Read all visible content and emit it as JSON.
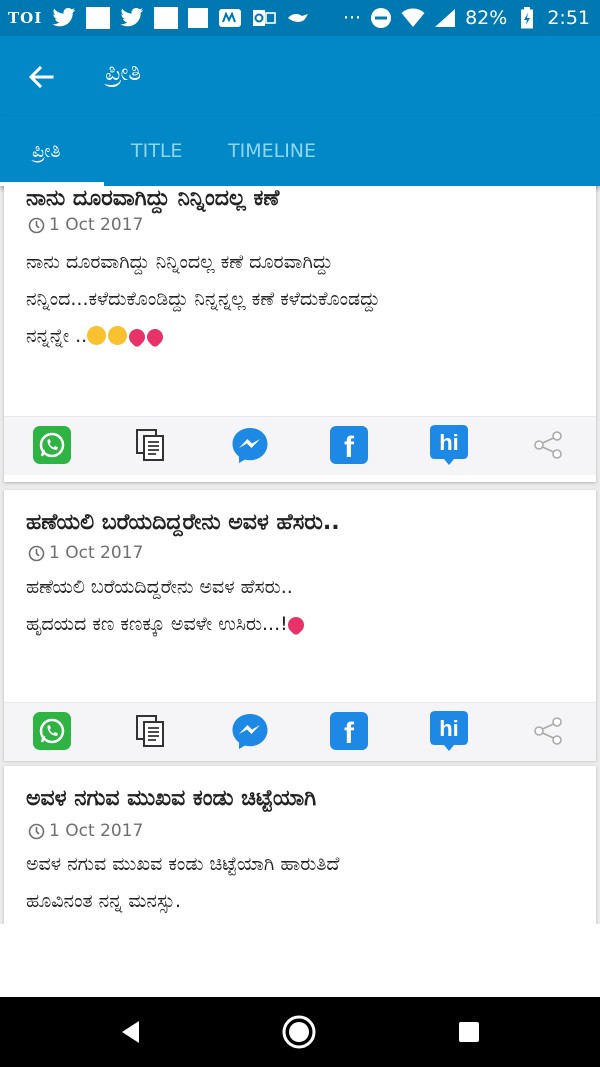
{
  "status_bar": {
    "left_label": "TOI",
    "more": "···",
    "battery": "82%",
    "time": "2:51",
    "icons": [
      "twitter-icon",
      "square-icon",
      "twitter-icon",
      "square-icon",
      "square-icon",
      "mywall-icon",
      "outlook-icon",
      "bird-icon",
      "dnd-icon",
      "wifi-icon",
      "signal-icon",
      "battery-icon"
    ]
  },
  "app_bar": {
    "title": "ಪ್ರೀತಿ"
  },
  "tabs": [
    {
      "label": "ಪ್ರೀತಿ",
      "active": true
    },
    {
      "label": "TITLE",
      "active": false
    },
    {
      "label": "TIMELINE",
      "active": false
    }
  ],
  "posts": [
    {
      "title": "ನಾನು ದೂರವಾಗಿದ್ದು ನಿನ್ನಿಂದಲ್ಲ ಕಣೆ",
      "date": "1 Oct 2017",
      "lines": [
        "ನಾನು ದೂರವಾಗಿದ್ದು ನಿನ್ನಿಂದಲ್ಲ ಕಣೆ ದೂರವಾಗಿದ್ದು",
        "ನನ್ನಿಂದ...ಕಳೆದುಕೊಂಡಿದ್ದು ನಿನ್ನನ್ನಲ್ಲ ಕಣೆ ಕಳೆದುಕೊಂಡದ್ದು",
        "ನನ್ನನ್ನೇ .."
      ]
    },
    {
      "title": "ಹಣೆಯಲಿ ಬರೆಯದಿದ್ದರೇನು ಅವಳ ಹೆಸರು..",
      "date": "1 Oct 2017",
      "lines": [
        "ಹಣೆಯಲಿ ಬರೆಯದಿದ್ದರೇನು ಅವಳ ಹೆಸರು..",
        "ಹೃದಯದ ಕಣ ಕಣಕ್ಕೂ ಅವಳೇ ಉಸಿರು...!"
      ]
    },
    {
      "title": "ಅವಳ ನಗುವ ಮುಖವ ಕಂಡು ಚಿಟ್ಟೆಯಾಗಿ",
      "date": "1 Oct 2017",
      "lines": [
        "ಅವಳ ನಗುವ ಮುಖವ ಕಂಡು ಚಿಟ್ಟೆಯಾಗಿ ಹಾರುತಿದೆ",
        "ಹೂವಿನಂತ ನನ್ನ ಮನಸ್ಸು."
      ]
    }
  ],
  "share_actions": {
    "hike_label": "hi",
    "facebook_label": "f",
    "icons": [
      "whatsapp-icon",
      "copy-icon",
      "messenger-icon",
      "facebook-icon",
      "hike-icon",
      "share-icon"
    ]
  },
  "colors": {
    "status_bar": "#0079b2",
    "app_bar": "#0288c7",
    "tab_inactive": "#8fd5f8",
    "whatsapp": "#2fb342",
    "messenger": "#1e88e5",
    "facebook": "#1e88e5",
    "hike": "#1e88e5"
  }
}
